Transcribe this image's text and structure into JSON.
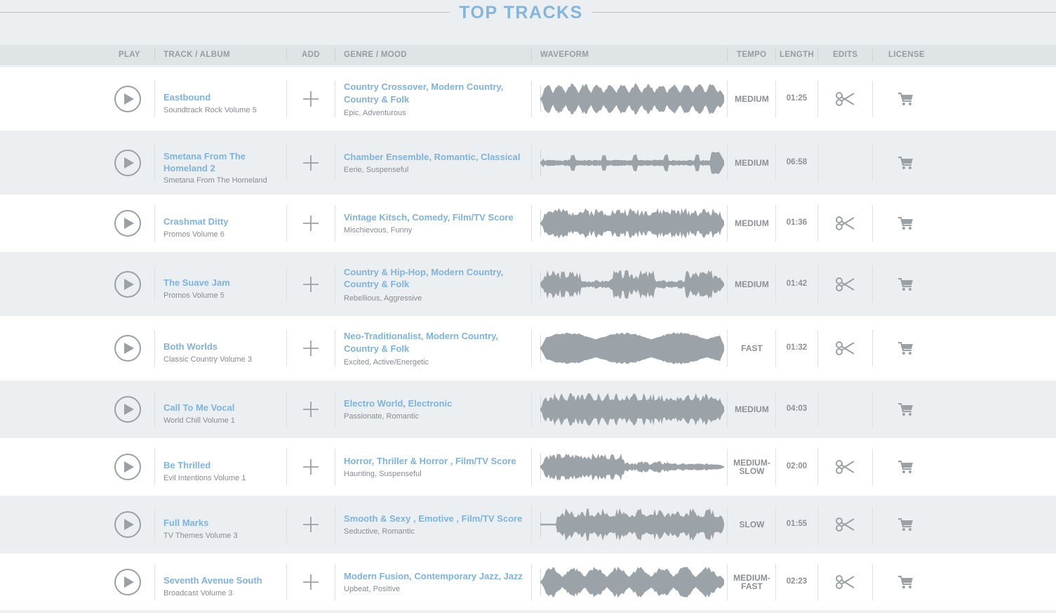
{
  "page": {
    "title": "TOP TRACKS"
  },
  "columns": {
    "play": "PLAY",
    "track": "TRACK / ALBUM",
    "add": "ADD",
    "genre": "GENRE / MOOD",
    "waveform": "WAVEFORM",
    "tempo": "TEMPO",
    "length": "LENGTH",
    "edits": "EDITS",
    "license": "LICENSE"
  },
  "colors": {
    "accent": "#7fb2dc",
    "title": "#84b5dc",
    "waveform": "#9ba3a8",
    "row_alt": "#eceff1",
    "header_band": "#dfe4e7"
  },
  "icons": {
    "play": "play-icon",
    "add": "plus-icon",
    "edits": "scissors-icon",
    "license": "cart-icon"
  },
  "tracks": [
    {
      "title": "Eastbound",
      "album": "Soundtrack Rock Volume 5",
      "genre_line1": [
        "Country Crossover",
        "Modern Country"
      ],
      "genre_line2": [
        "Country & Folk"
      ],
      "mood": "Epic, Adventurous",
      "tempo_line1": "MEDIUM",
      "tempo_line2": "",
      "length": "01:25",
      "has_edits": true
    },
    {
      "title": "Smetana From The Homeland 2",
      "album": "Smetana From The Homeland",
      "genre_line1": [
        "Chamber Ensemble",
        "Romantic",
        "Classical"
      ],
      "genre_line2": [],
      "mood": "Eerie, Suspenseful",
      "tempo_line1": "MEDIUM",
      "tempo_line2": "",
      "length": "06:58",
      "has_edits": false
    },
    {
      "title": "Crashmat Ditty",
      "album": "Promos Volume 6",
      "genre_line1": [
        "Vintage Kitsch",
        "Comedy",
        "Film/TV Score"
      ],
      "genre_line2": [],
      "mood": "Mischievous, Funny",
      "tempo_line1": "MEDIUM",
      "tempo_line2": "",
      "length": "01:36",
      "has_edits": true
    },
    {
      "title": "The Suave Jam",
      "album": "Promos Volume 5",
      "genre_line1": [
        "Country & Hip-Hop",
        "Modern Country"
      ],
      "genre_line2": [
        "Country & Folk"
      ],
      "mood": "Rebellious, Aggressive",
      "tempo_line1": "MEDIUM",
      "tempo_line2": "",
      "length": "01:42",
      "has_edits": true
    },
    {
      "title": "Both Worlds",
      "album": "Classic Country Volume 3",
      "genre_line1": [
        "Neo-Traditionalist",
        "Modern Country"
      ],
      "genre_line2": [
        "Country & Folk"
      ],
      "mood": "Excited, Active/Energetic",
      "tempo_line1": "FAST",
      "tempo_line2": "",
      "length": "01:32",
      "has_edits": true
    },
    {
      "title": "Call To Me Vocal",
      "album": "World Chill Volume 1",
      "genre_line1": [
        "Electro World",
        "Electronic"
      ],
      "genre_line2": [],
      "mood": "Passionate, Romantic",
      "tempo_line1": "MEDIUM",
      "tempo_line2": "",
      "length": "04:03",
      "has_edits": false
    },
    {
      "title": "Be Thrilled",
      "album": "Evil Intentions Volume 1",
      "genre_line1": [
        "Horror",
        "Thriller & Horror ",
        "Film/TV Score"
      ],
      "genre_line2": [],
      "mood": "Haunting, Suspenseful",
      "tempo_line1": "MEDIUM-",
      "tempo_line2": "SLOW",
      "length": "02:00",
      "has_edits": true
    },
    {
      "title": "Full Marks",
      "album": "TV Themes Volume 3",
      "genre_line1": [
        "Smooth & Sexy ",
        "Emotive ",
        "Film/TV Score"
      ],
      "genre_line2": [],
      "mood": "Seductive, Romantic",
      "tempo_line1": "SLOW",
      "tempo_line2": "",
      "length": "01:55",
      "has_edits": true
    },
    {
      "title": "Seventh Avenue South",
      "album": "Broadcast Volume 3",
      "genre_line1": [
        "Modern Fusion",
        "Contemporary Jazz",
        "Jazz"
      ],
      "genre_line2": [],
      "mood": "Upbeat, Positive",
      "tempo_line1": "MEDIUM-",
      "tempo_line2": "FAST",
      "length": "02:23",
      "has_edits": true
    }
  ]
}
